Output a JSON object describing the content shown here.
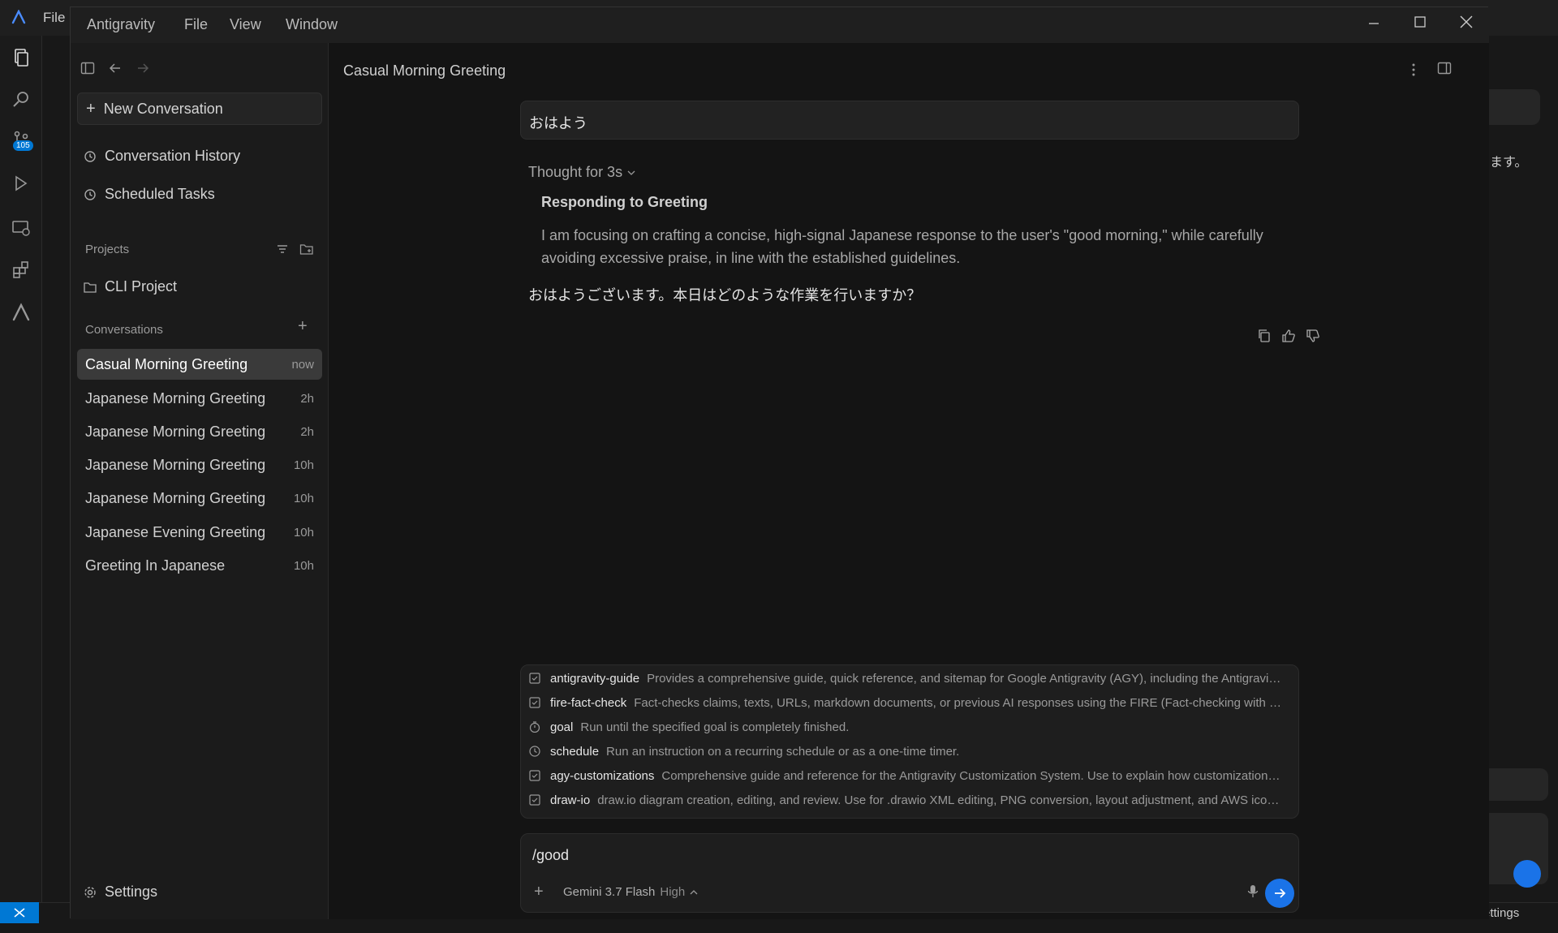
{
  "ide": {
    "file_menu": "File",
    "scm_badge": "105",
    "right_panel_text": "ます。",
    "status_settings": "Settings"
  },
  "window": {
    "menus": [
      "Antigravity",
      "File",
      "View",
      "Window"
    ]
  },
  "sidebar": {
    "new_conversation": "New Conversation",
    "conversation_history": "Conversation History",
    "scheduled_tasks": "Scheduled Tasks",
    "projects_label": "Projects",
    "projects": [
      "CLI Project"
    ],
    "conversations_label": "Conversations",
    "conversations": [
      {
        "title": "Casual Morning Greeting",
        "age": "now",
        "active": true
      },
      {
        "title": "Japanese Morning Greeting",
        "age": "2h"
      },
      {
        "title": "Japanese Morning Greeting",
        "age": "2h"
      },
      {
        "title": "Japanese Morning Greeting",
        "age": "10h"
      },
      {
        "title": "Japanese Morning Greeting",
        "age": "10h"
      },
      {
        "title": "Japanese Evening Greeting",
        "age": "10h"
      },
      {
        "title": "Greeting In Japanese",
        "age": "10h"
      }
    ],
    "settings": "Settings"
  },
  "chat": {
    "title": "Casual Morning Greeting",
    "user_message": "おはよう",
    "thought_label": "Thought for 3s",
    "thought_heading": "Responding to Greeting",
    "thought_body": "I am focusing on crafting a concise, high-signal Japanese response to the user's \"good morning,\" while carefully avoiding excessive praise, in line with the established guidelines.",
    "reply": "おはようございます。本日はどのような作業を行いますか？"
  },
  "suggestions": [
    {
      "name": "antigravity-guide",
      "desc": "Provides a comprehensive guide, quick reference, and sitemap for Google Antigravity (AGY), including the Antigravity...",
      "icon": "skill-icon"
    },
    {
      "name": "fire-fact-check",
      "desc": "Fact-checks claims, texts, URLs, markdown documents, or previous AI responses using the FIRE (Fact-checking with Iterat...",
      "icon": "skill-icon"
    },
    {
      "name": "goal",
      "desc": "Run until the specified goal is completely finished.",
      "icon": "timer-icon"
    },
    {
      "name": "schedule",
      "desc": "Run an instruction on a recurring schedule or as a one-time timer.",
      "icon": "clock-icon"
    },
    {
      "name": "agy-customizations",
      "desc": "Comprehensive guide and reference for the Antigravity Customization System. Use to explain how customizations ...",
      "icon": "skill-icon"
    },
    {
      "name": "draw-io",
      "desc": "draw.io diagram creation, editing, and review. Use for .drawio XML editing, PNG conversion, layout adjustment, and AWS icon ...",
      "icon": "skill-icon"
    }
  ],
  "composer": {
    "text": "/good",
    "model": "Gemini 3.7 Flash",
    "mode": "High"
  },
  "colors": {
    "accent": "#1a73e8",
    "active_item": "#3a3a3a"
  }
}
